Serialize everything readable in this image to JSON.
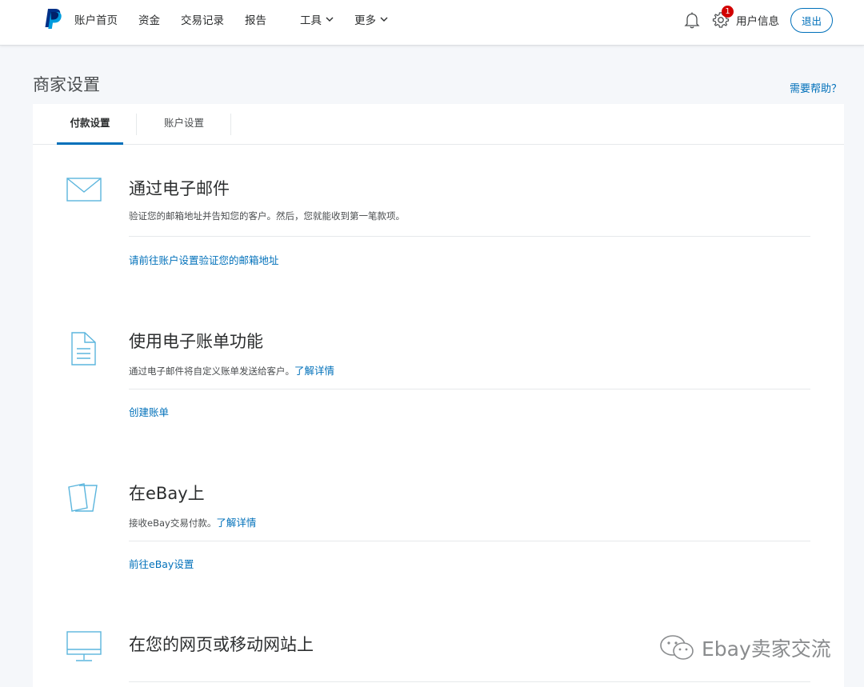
{
  "nav": {
    "items": [
      {
        "label": "账户首页"
      },
      {
        "label": "资金"
      },
      {
        "label": "交易记录"
      },
      {
        "label": "报告"
      },
      {
        "label": "工具",
        "dropdown": true
      },
      {
        "label": "更多",
        "dropdown": true
      }
    ],
    "notification_count": "1",
    "user_info": "用户信息",
    "logout": "退出"
  },
  "page": {
    "title": "商家设置",
    "help": "需要帮助？"
  },
  "tabs": [
    {
      "label": "付款设置",
      "active": true
    },
    {
      "label": "账户设置",
      "active": false
    }
  ],
  "sections": [
    {
      "icon": "envelope-icon",
      "title": "通过电子邮件",
      "description": "验证您的邮箱地址并告知您的客户。然后，您就能收到第一笔款项。",
      "learn_more": "",
      "action": "请前往账户设置验证您的邮箱地址"
    },
    {
      "icon": "document-icon",
      "title": "使用电子账单功能",
      "description": "通过电子邮件将自定义账单发送给客户。",
      "learn_more": "了解详情",
      "action": "创建账单"
    },
    {
      "icon": "cards-icon",
      "title": "在eBay上",
      "description": "接收eBay交易付款。",
      "learn_more": "了解详情",
      "action": "前往eBay设置"
    },
    {
      "icon": "monitor-icon",
      "title": "在您的网页或移动网站上",
      "description": "",
      "learn_more": "",
      "action": ""
    }
  ],
  "watermark": "Ebay卖家交流",
  "colors": {
    "accent": "#0070ba",
    "badge": "#d20000",
    "icon": "#5bb5dd"
  }
}
